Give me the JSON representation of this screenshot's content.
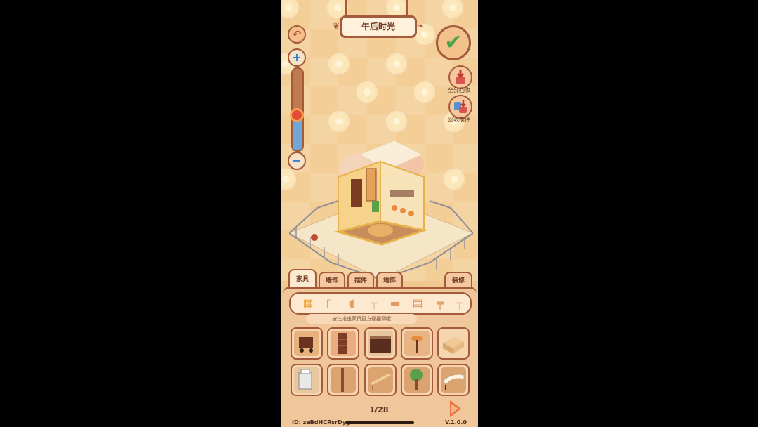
{
  "scene": {
    "title": "午后时光"
  },
  "controls": {
    "undo_icon": "undo-arrow-icon",
    "zoom_in_icon": "plus-icon",
    "zoom_out_icon": "minus-icon",
    "zoom_level": 0.43,
    "confirm_icon": "checkmark-icon",
    "recycle_all_label": "全部回收",
    "recycle_items_label": "回收摆件"
  },
  "panel": {
    "tabs": [
      {
        "label": "家具",
        "active": true
      },
      {
        "label": "墙饰",
        "active": false
      },
      {
        "label": "摆件",
        "active": false
      },
      {
        "label": "地饰",
        "active": false
      }
    ],
    "decorate_label": "装修",
    "categories": [
      "grid-icon",
      "cabinet-icon",
      "toilet-icon",
      "table-icon",
      "bed-icon",
      "dresser-icon",
      "desk-icon",
      "lamp-icon"
    ],
    "hint": "按住拖出家具更方便摆调哦",
    "items": [
      {
        "name": "mailbox-cart"
      },
      {
        "name": "bookshelf"
      },
      {
        "name": "counter-cabinet"
      },
      {
        "name": "bar-stool"
      },
      {
        "name": "storage-box"
      },
      {
        "name": "copier"
      },
      {
        "name": "wood-panel"
      },
      {
        "name": "long-bench"
      },
      {
        "name": "fan-plant"
      },
      {
        "name": "curved-desk"
      }
    ],
    "page": "1/28",
    "id_text": "ID:  zeBdHCRsrDyg",
    "version": "V.1.0.0"
  },
  "colors": {
    "accent": "#a45a3b",
    "check": "#4aa34d",
    "bg": "#f3cf97"
  }
}
